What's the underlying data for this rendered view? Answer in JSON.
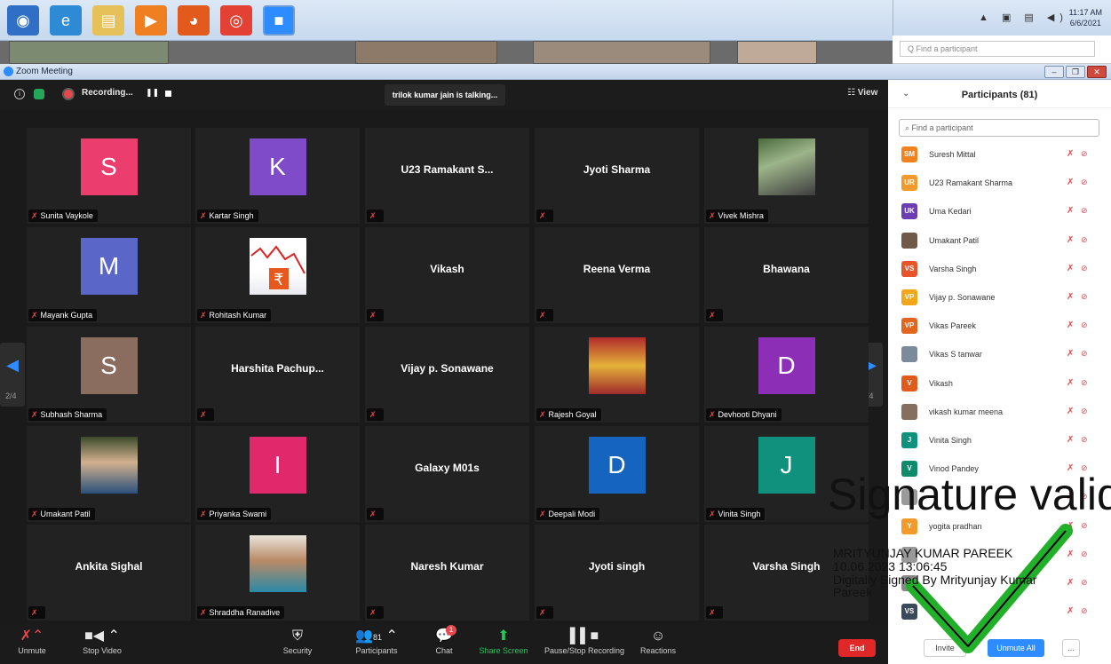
{
  "taskbar": {
    "apps": [
      {
        "icon": "start-orb-icon",
        "color": "#2f6fc5"
      },
      {
        "icon": "internet-explorer-icon",
        "color": "#2f8ad6"
      },
      {
        "icon": "file-explorer-icon",
        "color": "#e6c15a"
      },
      {
        "icon": "media-player-icon",
        "color": "#f07f22"
      },
      {
        "icon": "firefox-icon",
        "color": "#e25a1c"
      },
      {
        "icon": "chrome-icon",
        "color": "#e34133"
      },
      {
        "icon": "zoom-icon",
        "color": "#2d8cff"
      }
    ]
  },
  "tray": {
    "time": "11:17 AM",
    "date": "6/6/2021"
  },
  "behind": {
    "search_placeholder": "Find a participant"
  },
  "window": {
    "title": "Zoom Meeting",
    "min": "–",
    "max": "❐",
    "close": "✕"
  },
  "topbar": {
    "info": "i",
    "recording": "Recording...",
    "pause": "❚❚",
    "talking": "trilok kumar jain is talking...",
    "view": "☷ View"
  },
  "grid": {
    "page": "2/4",
    "tiles": [
      {
        "kind": "avatar",
        "letter": "S",
        "color": "#ec3e6e",
        "label": "Sunita Vaykole"
      },
      {
        "kind": "avatar",
        "letter": "K",
        "color": "#7f4bc8",
        "label": "Kartar Singh"
      },
      {
        "kind": "name",
        "display": "U23 Ramakant S...",
        "label": ""
      },
      {
        "kind": "name",
        "display": "Jyoti Sharma",
        "label": ""
      },
      {
        "kind": "photo",
        "photo": "vivek",
        "label": "Vivek Mishra"
      },
      {
        "kind": "avatar",
        "letter": "M",
        "color": "#5a67c8",
        "label": "Mayank Gupta"
      },
      {
        "kind": "photo",
        "photo": "rupee",
        "label": "Rohitash Kumar"
      },
      {
        "kind": "name",
        "display": "Vikash",
        "label": ""
      },
      {
        "kind": "name",
        "display": "Reena Verma",
        "label": ""
      },
      {
        "kind": "name",
        "display": "Bhawana",
        "label": ""
      },
      {
        "kind": "avatar",
        "letter": "S",
        "color": "#8a6d5e",
        "label": "Subhash Sharma"
      },
      {
        "kind": "name",
        "display": "Harshita Pachup...",
        "label": ""
      },
      {
        "kind": "name",
        "display": "Vijay p. Sonawane",
        "label": ""
      },
      {
        "kind": "photo",
        "photo": "deity",
        "label": "Rajesh Goyal"
      },
      {
        "kind": "avatar",
        "letter": "D",
        "color": "#8d2fb6",
        "label": "Devhooti Dhyani"
      },
      {
        "kind": "photo",
        "photo": "man",
        "label": "Umakant Patil"
      },
      {
        "kind": "avatar",
        "letter": "I",
        "color": "#e0286b",
        "label": "Priyanka Swami"
      },
      {
        "kind": "name",
        "display": "Galaxy M01s",
        "label": ""
      },
      {
        "kind": "avatar",
        "letter": "D",
        "color": "#1565c0",
        "label": "Deepali Modi"
      },
      {
        "kind": "avatar",
        "letter": "J",
        "color": "#10917e",
        "label": "Vinita Singh"
      },
      {
        "kind": "name",
        "display": "Ankita Sighal",
        "label": ""
      },
      {
        "kind": "photo",
        "photo": "woman",
        "label": "Shraddha Ranadive"
      },
      {
        "kind": "name",
        "display": "Naresh Kumar",
        "label": ""
      },
      {
        "kind": "name",
        "display": "Jyoti singh",
        "label": ""
      },
      {
        "kind": "name",
        "display": "Varsha Singh",
        "label": ""
      }
    ]
  },
  "toolbar": {
    "unmute": "Unmute",
    "stop_video": "Stop Video",
    "security": "Security",
    "participants": "Participants",
    "participants_count": "81",
    "chat": "Chat",
    "chat_badge": "1",
    "share_screen": "Share Screen",
    "pause_recording": "Pause/Stop Recording",
    "reactions": "Reactions",
    "end": "End"
  },
  "panel": {
    "title": "Participants (81)",
    "search_placeholder": "Find a participant",
    "participants": [
      {
        "initials": "SM",
        "color": "#f2821f",
        "name": "Suresh Mittal"
      },
      {
        "initials": "UR",
        "color": "#f29b2c",
        "name": "U23 Ramakant Sharma"
      },
      {
        "initials": "UK",
        "color": "#6b3fb3",
        "name": "Uma Kedari"
      },
      {
        "initials": "",
        "color": "#6f5a4a",
        "name": "Umakant Patil"
      },
      {
        "initials": "VS",
        "color": "#e8552b",
        "name": "Varsha Singh"
      },
      {
        "initials": "VP",
        "color": "#f2a619",
        "name": "Vijay p. Sonawane"
      },
      {
        "initials": "VP",
        "color": "#e2661e",
        "name": "Vikas Pareek"
      },
      {
        "initials": "",
        "color": "#7c8b99",
        "name": "Vikas S tanwar"
      },
      {
        "initials": "V",
        "color": "#e05b1c",
        "name": "Vikash"
      },
      {
        "initials": "",
        "color": "#85705f",
        "name": "vikash kumar meena"
      },
      {
        "initials": "J",
        "color": "#10917e",
        "name": "Vinita Singh"
      },
      {
        "initials": "V",
        "color": "#0f8a6a",
        "name": "Vinod Pandey"
      },
      {
        "initials": "",
        "color": "#9a9a9a",
        "name": ""
      },
      {
        "initials": "Y",
        "color": "#f29b2c",
        "name": "yogita pradhan"
      },
      {
        "initials": "",
        "color": "#9a9a9a",
        "name": ""
      },
      {
        "initials": "",
        "color": "#888",
        "name": ""
      },
      {
        "initials": "VS",
        "color": "#3b4a5a",
        "name": ""
      }
    ],
    "invite": "Invite",
    "unmute_all": "Unmute All",
    "more": "..."
  },
  "signature": {
    "title": "Signature valid",
    "line1": "MRITYUNJAY KUMAR PAREEK",
    "line2": "10.06.2023 13:06:45",
    "line3": "Digitally Signed By Mrityunjay Kumar",
    "line4": "Pareek",
    "check_color": "#22b02b"
  }
}
